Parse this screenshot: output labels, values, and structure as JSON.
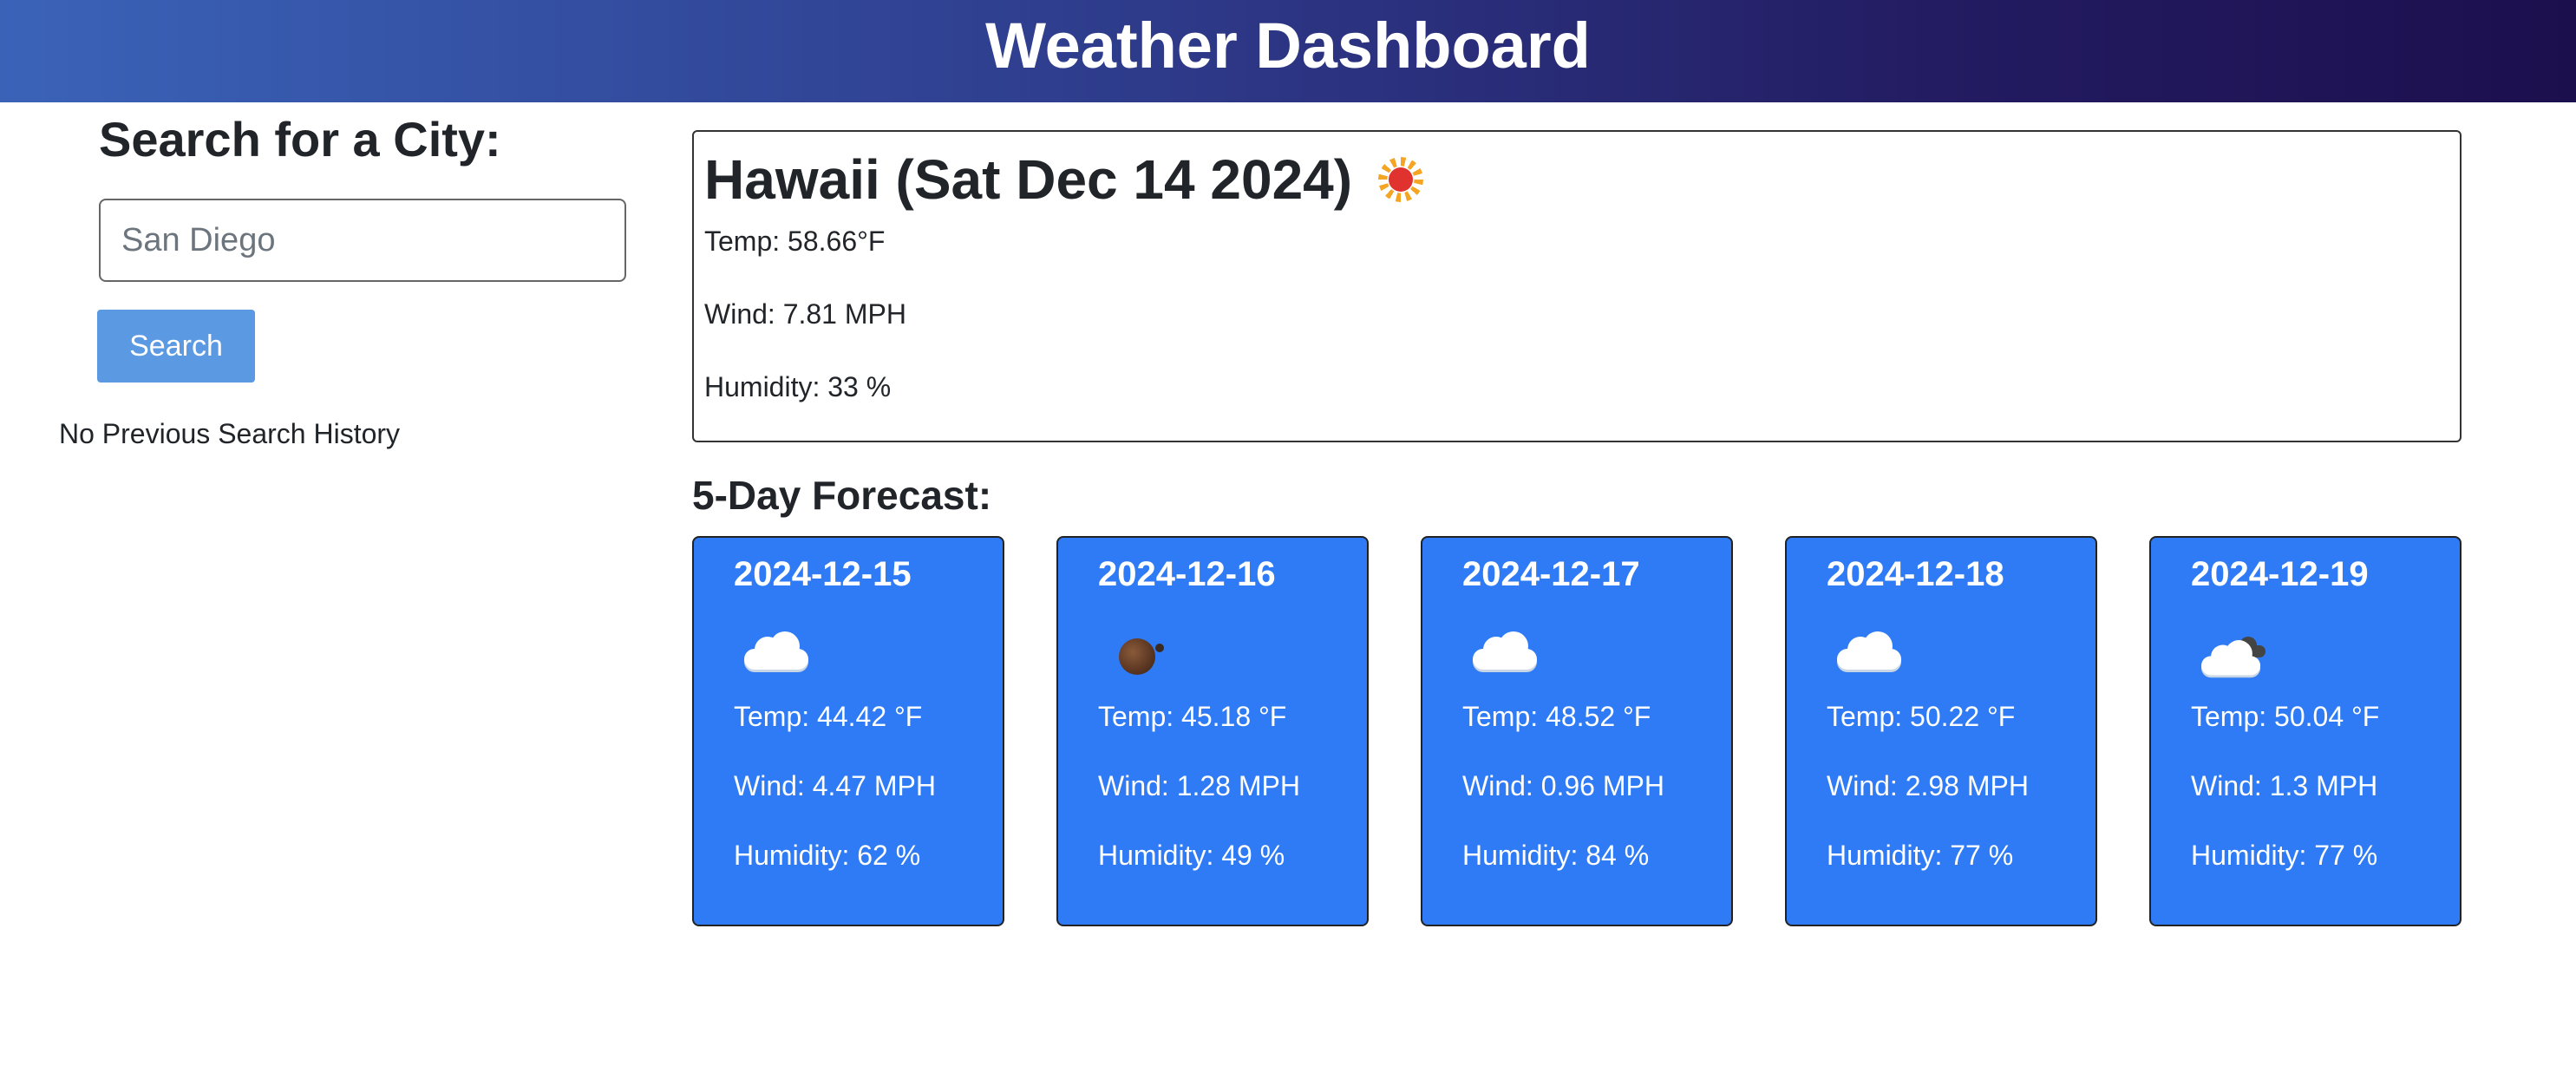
{
  "header": {
    "title": "Weather Dashboard"
  },
  "search": {
    "heading": "Search for a City:",
    "placeholder": "San Diego",
    "value": "",
    "button_label": "Search",
    "history_empty": "No Previous Search History"
  },
  "current": {
    "title": "Hawaii (Sat Dec 14 2024)",
    "icon": "sun-icon",
    "temp": "Temp: 58.66°F",
    "wind": "Wind: 7.81 MPH",
    "humidity": "Humidity: 33 %"
  },
  "forecast": {
    "heading": "5-Day Forecast:",
    "days": [
      {
        "date": "2024-12-15",
        "icon": "cloud-icon",
        "temp": "Temp: 44.42 °F",
        "wind": "Wind: 4.47 MPH",
        "humidity": "Humidity: 62 %"
      },
      {
        "date": "2024-12-16",
        "icon": "moon-icon",
        "temp": "Temp: 45.18 °F",
        "wind": "Wind: 1.28 MPH",
        "humidity": "Humidity: 49 %"
      },
      {
        "date": "2024-12-17",
        "icon": "cloud-icon",
        "temp": "Temp: 48.52 °F",
        "wind": "Wind: 0.96 MPH",
        "humidity": "Humidity: 84 %"
      },
      {
        "date": "2024-12-18",
        "icon": "cloud-icon",
        "temp": "Temp: 50.22 °F",
        "wind": "Wind: 2.98 MPH",
        "humidity": "Humidity: 77 %"
      },
      {
        "date": "2024-12-19",
        "icon": "partly-cloudy-icon",
        "temp": "Temp: 50.04 °F",
        "wind": "Wind: 1.3 MPH",
        "humidity": "Humidity: 77 %"
      }
    ]
  },
  "colors": {
    "card_bg": "#2f7bf5",
    "search_button": "#5b9ae2",
    "header_gradient_start": "#3a63b8",
    "header_gradient_end": "#1c0f4e"
  }
}
